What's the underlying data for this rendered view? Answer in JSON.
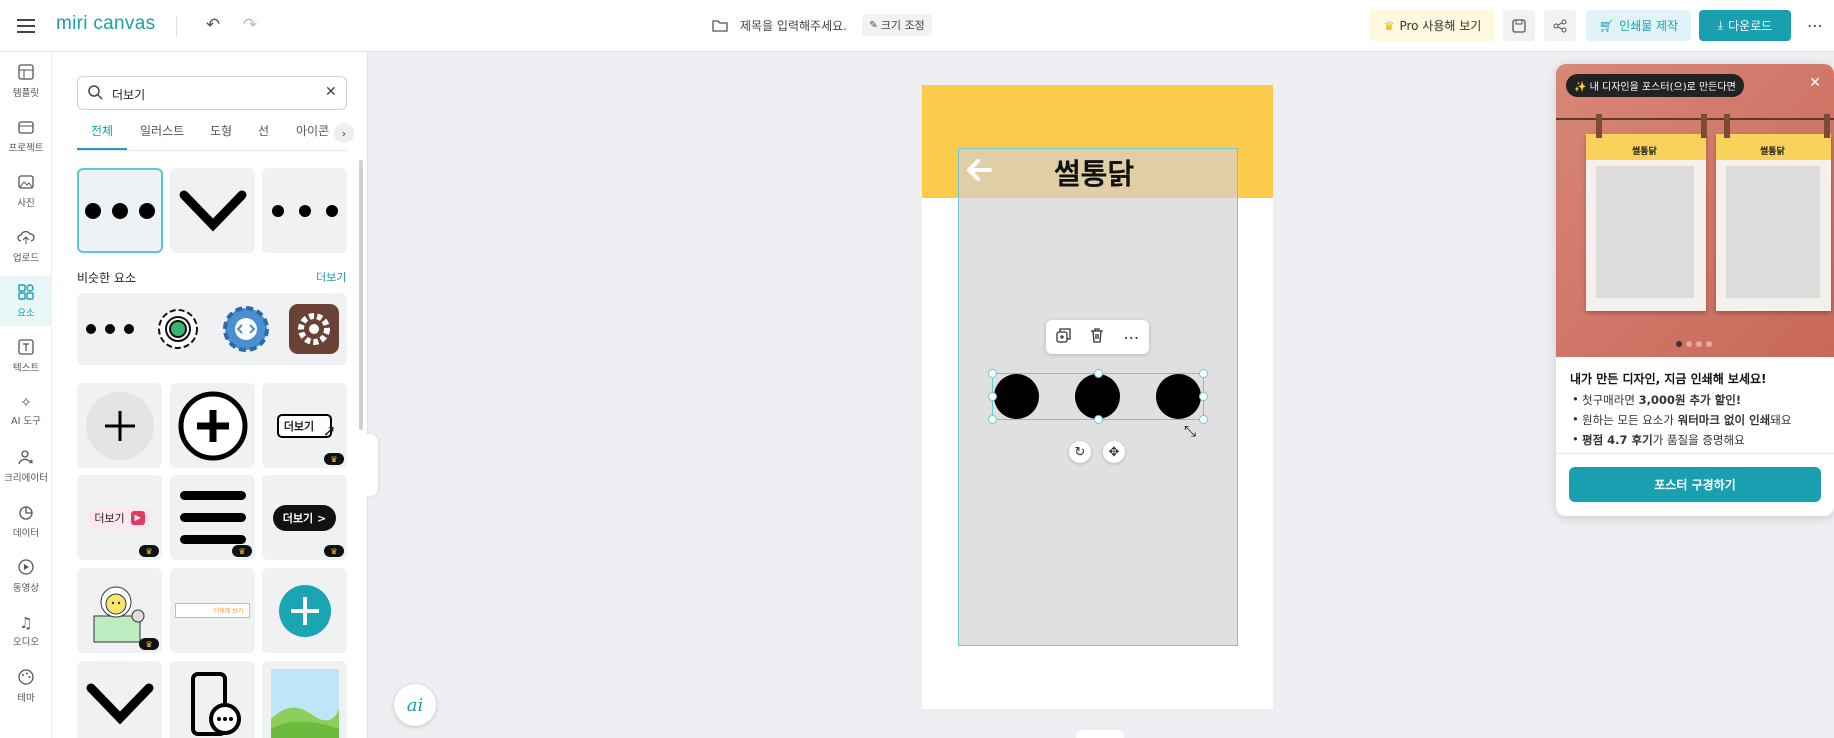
{
  "app": {
    "logo": "miri canvas",
    "title_placeholder": "제목을 입력해주세요.",
    "resize_label": "크기 조정"
  },
  "header": {
    "pro_label": "Pro 사용해 보기",
    "print_label": "인쇄물 제작",
    "download_label": "다운로드"
  },
  "rail": {
    "items": [
      {
        "label": "템플릿",
        "icon": "template-icon"
      },
      {
        "label": "프로젝트",
        "icon": "project-icon"
      },
      {
        "label": "사진",
        "icon": "photo-icon"
      },
      {
        "label": "업로드",
        "icon": "upload-icon"
      },
      {
        "label": "요소",
        "icon": "elements-icon"
      },
      {
        "label": "텍스트",
        "icon": "text-icon"
      },
      {
        "label": "AI 도구",
        "icon": "ai-tools-icon"
      },
      {
        "label": "크리에이터",
        "icon": "creator-icon"
      },
      {
        "label": "데이터",
        "icon": "data-icon"
      },
      {
        "label": "동영상",
        "icon": "video-icon"
      },
      {
        "label": "오디오",
        "icon": "audio-icon"
      },
      {
        "label": "테마",
        "icon": "theme-icon"
      }
    ]
  },
  "panel": {
    "search_value": "더보기",
    "tabs": [
      "전체",
      "일러스트",
      "도형",
      "선",
      "아이콘"
    ],
    "similar_label": "비슷한 요소",
    "more_label": "더보기",
    "tile_texts": {
      "more_btn1": "더보기",
      "more_btn2": "더보기",
      "more_btn3": "더보기 >",
      "tiny_bar": "더해해 보기"
    }
  },
  "canvas": {
    "title": "썰통닭",
    "ai_label": "ai"
  },
  "promo": {
    "badge": "✨ 내 디자인을 포스터(으)로 만든다면",
    "mini_title": "썰통닭",
    "heading": "내가 만든 디자인, 지금 인쇄해 보세요!",
    "b1_pre": "첫구매라면 ",
    "b1_bold": "3,000원 추가 할인!",
    "b2_pre": "원하는 모든 요소가 ",
    "b2_bold": "워터마크 없이 인쇄",
    "b2_post": "돼요",
    "b3_bold": "평점 4.7 후기",
    "b3_post": "가 품질을 증명해요",
    "cta": "포스터 구경하기"
  },
  "colors": {
    "accent": "#1a9fb0",
    "canvas_yellow": "#fdcb4b",
    "selection": "#6cc9d6"
  }
}
